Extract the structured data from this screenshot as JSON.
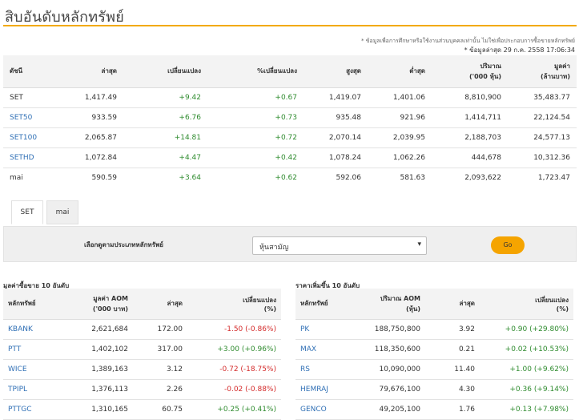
{
  "page": {
    "title": "สิบอันดับหลักทรัพย์"
  },
  "notes": {
    "disclaimer": "* ข้อมูลเพื่อการศึกษาหรือใช้งานส่วนบุคคลเท่านั้น ไม่ใช่เพื่อประกอบการซื้อขายหลักทรัพย์",
    "as_of": "* ข้อมูลล่าสุด 29 ก.ค. 2558 17:06:34"
  },
  "index_table": {
    "headers": [
      "ดัชนี",
      "ล่าสุด",
      "เปลี่ยนแปลง",
      "%เปลี่ยนแปลง",
      "สูงสุด",
      "ต่ำสุด",
      "ปริมาณ\n('000 หุ้น)",
      "มูลค่า\n(ล้านบาท)"
    ],
    "rows": [
      {
        "name": "SET",
        "last": "1,417.49",
        "change": "+9.42",
        "pct": "+0.67",
        "high": "1,419.07",
        "low": "1,401.06",
        "volume": "8,810,900",
        "value": "35,483.77"
      },
      {
        "name": "SET50",
        "last": "933.59",
        "change": "+6.76",
        "pct": "+0.73",
        "high": "935.48",
        "low": "921.96",
        "volume": "1,414,711",
        "value": "22,124.54"
      },
      {
        "name": "SET100",
        "last": "2,065.87",
        "change": "+14.81",
        "pct": "+0.72",
        "high": "2,070.14",
        "low": "2,039.95",
        "volume": "2,188,703",
        "value": "24,577.13"
      },
      {
        "name": "SETHD",
        "last": "1,072.84",
        "change": "+4.47",
        "pct": "+0.42",
        "high": "1,078.24",
        "low": "1,062.26",
        "volume": "444,678",
        "value": "10,312.36"
      },
      {
        "name": "mai",
        "last": "590.59",
        "change": "+3.64",
        "pct": "+0.62",
        "high": "592.06",
        "low": "581.63",
        "volume": "2,093,622",
        "value": "1,723.47"
      }
    ]
  },
  "tabs": [
    {
      "label": "SET"
    },
    {
      "label": "mai"
    }
  ],
  "filter": {
    "label": "เลือกดูตามประเภทหลักทรัพย์",
    "selected": "หุ้นสามัญ",
    "go_label": "Go"
  },
  "top_value": {
    "title": "มูลค่าซื้อขาย 10 อันดับ",
    "headers": [
      "หลักทรัพย์",
      "มูลค่า AOM\n('000 บาท)",
      "ล่าสุด",
      "เปลี่ยนแปลง\n(%)"
    ],
    "rows": [
      {
        "symbol": "KBANK",
        "aom": "2,621,684",
        "last": "172.00",
        "change": "-1.50 (-0.86%)"
      },
      {
        "symbol": "PTT",
        "aom": "1,402,102",
        "last": "317.00",
        "change": "+3.00 (+0.96%)"
      },
      {
        "symbol": "WICE",
        "aom": "1,389,163",
        "last": "3.12",
        "change": "-0.72 (-18.75%)"
      },
      {
        "symbol": "TPIPL",
        "aom": "1,376,113",
        "last": "2.26",
        "change": "-0.02 (-0.88%)"
      },
      {
        "symbol": "PTTGC",
        "aom": "1,310,165",
        "last": "60.75",
        "change": "+0.25 (+0.41%)"
      }
    ]
  },
  "top_gainers": {
    "title": "ราคาเพิ่มขึ้น 10 อันดับ",
    "headers": [
      "หลักทรัพย์",
      "ปริมาณ AOM\n(หุ้น)",
      "ล่าสุด",
      "เปลี่ยนแปลง\n(%)"
    ],
    "rows": [
      {
        "symbol": "PK",
        "aom": "188,750,800",
        "last": "3.92",
        "change": "+0.90 (+29.80%)"
      },
      {
        "symbol": "MAX",
        "aom": "118,350,600",
        "last": "0.21",
        "change": "+0.02 (+10.53%)"
      },
      {
        "symbol": "RS",
        "aom": "10,090,000",
        "last": "11.40",
        "change": "+1.00 (+9.62%)"
      },
      {
        "symbol": "HEMRAJ",
        "aom": "79,676,100",
        "last": "4.30",
        "change": "+0.36 (+9.14%)"
      },
      {
        "symbol": "GENCO",
        "aom": "49,205,100",
        "last": "1.76",
        "change": "+0.13 (+7.98%)"
      }
    ]
  },
  "colors": {
    "accent": "#f2a900",
    "positive": "#2e8b2e",
    "negative": "#d42a2a",
    "link": "#2f6fb5",
    "header_bg": "#f3f3f3"
  }
}
